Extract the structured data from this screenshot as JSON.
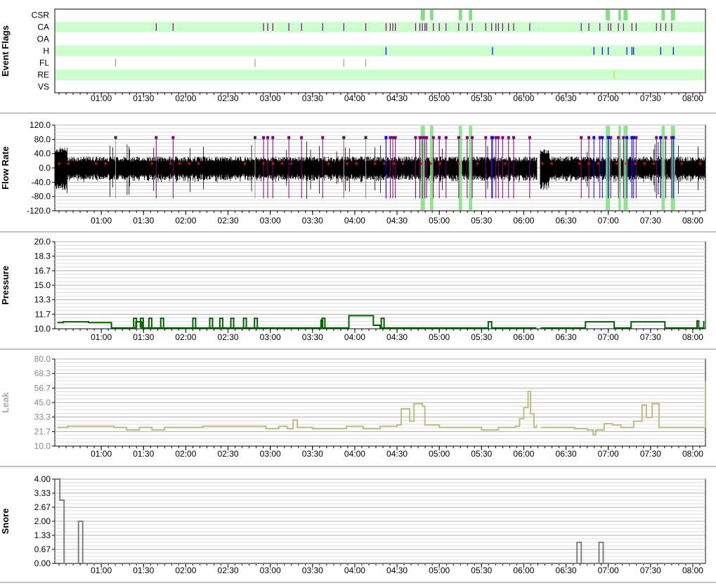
{
  "chart_data": [
    {
      "type": "event-flags",
      "ylabel": "Event Flags",
      "x_ticks": [
        "01:00",
        "01:30",
        "02:00",
        "02:30",
        "03:00",
        "03:30",
        "04:00",
        "04:30",
        "05:00",
        "05:30",
        "06:00",
        "06:30",
        "07:00",
        "07:30",
        "08:00"
      ],
      "rows": [
        {
          "label": "CSR",
          "color": "#7ee07e",
          "spans": [
            [
              4.78,
              4.83
            ],
            [
              4.89,
              4.93
            ],
            [
              5.23,
              5.27
            ],
            [
              5.35,
              5.39
            ],
            [
              6.97,
              7.02
            ],
            [
              7.12,
              7.15
            ],
            [
              7.18,
              7.23
            ],
            [
              7.63,
              7.67
            ],
            [
              7.74,
              7.79
            ]
          ]
        },
        {
          "label": "CA",
          "color": "#800080",
          "events": [
            1.65,
            1.85,
            2.92,
            2.97,
            3.03,
            3.22,
            3.37,
            3.62,
            3.87,
            4.13,
            4.37,
            4.42,
            4.45,
            4.48,
            4.72,
            4.77,
            4.8,
            4.83,
            4.85,
            4.93,
            5.0,
            5.08,
            5.23,
            5.33,
            5.39,
            5.55,
            5.62,
            5.67,
            5.7,
            5.75,
            5.82,
            5.88,
            6.07,
            6.68,
            6.77,
            6.9,
            7.0,
            7.03,
            7.12,
            7.18,
            7.28,
            7.33,
            7.57,
            7.62,
            7.68,
            7.75
          ]
        },
        {
          "label": "OA",
          "color": "#a04040",
          "events": []
        },
        {
          "label": "H",
          "color": "#0000ff",
          "events": [
            4.37,
            5.63,
            6.83,
            6.93,
            7.0,
            7.22,
            7.28,
            7.3,
            7.62,
            7.77
          ]
        },
        {
          "label": "FL",
          "color": "#9a9a9a",
          "events": [
            1.17,
            2.82,
            3.87,
            4.13
          ]
        },
        {
          "label": "RE",
          "color": "#e0e000",
          "events": [
            7.07
          ]
        },
        {
          "label": "VS",
          "color": "#800080",
          "events": [
            0.45
          ]
        }
      ]
    },
    {
      "type": "line",
      "ylabel": "Flow Rate",
      "y_ticks": [
        "120.0",
        "80.0",
        "40.0",
        "0.0",
        "-40.0",
        "-80.0",
        "-120.0"
      ],
      "ylim": [
        -120,
        120
      ],
      "x_ticks": [
        "01:00",
        "01:30",
        "02:00",
        "02:30",
        "03:00",
        "03:30",
        "04:00",
        "04:30",
        "05:00",
        "05:30",
        "06:00",
        "06:30",
        "07:00",
        "07:30",
        "08:00"
      ],
      "series": [
        {
          "color": "#000000",
          "envelope_baseline": [
            -20,
            20
          ]
        }
      ]
    },
    {
      "type": "line",
      "ylabel": "Pressure",
      "y_ticks": [
        "20.0",
        "18.3",
        "16.7",
        "15.0",
        "13.3",
        "11.7",
        "10.0"
      ],
      "ylim": [
        10,
        20
      ],
      "x_ticks": [
        "01:00",
        "01:30",
        "02:00",
        "02:30",
        "03:00",
        "03:30",
        "04:00",
        "04:30",
        "05:00",
        "05:30",
        "06:00",
        "06:30",
        "07:00",
        "07:30",
        "08:00"
      ],
      "series": [
        {
          "color": "#006400",
          "points": [
            [
              0.48,
              10.7
            ],
            [
              0.55,
              10.8
            ],
            [
              0.85,
              10.7
            ],
            [
              1.1,
              10.7
            ],
            [
              1.12,
              10.1
            ],
            [
              1.4,
              10.1
            ],
            [
              1.41,
              10.8
            ],
            [
              1.48,
              10.1
            ],
            [
              1.49,
              10.1
            ],
            [
              1.6,
              10.1
            ],
            [
              1.61,
              10.1
            ],
            [
              1.77,
              10.1
            ],
            [
              1.78,
              10.1
            ],
            [
              3.58,
              10.1
            ],
            [
              3.6,
              11.0
            ],
            [
              3.62,
              10.1
            ],
            [
              3.92,
              10.1
            ],
            [
              3.93,
              11.5
            ],
            [
              4.2,
              11.5
            ],
            [
              4.22,
              10.4
            ],
            [
              4.28,
              10.4
            ],
            [
              4.3,
              10.1
            ],
            [
              5.57,
              10.1
            ],
            [
              5.58,
              10.8
            ],
            [
              5.62,
              10.1
            ],
            [
              6.15,
              10.1
            ]
          ]
        },
        {
          "color": "#006400",
          "points": [
            [
              6.2,
              10.1
            ],
            [
              6.72,
              10.1
            ],
            [
              6.73,
              10.8
            ],
            [
              7.05,
              10.8
            ],
            [
              7.07,
              10.1
            ],
            [
              7.25,
              10.1
            ],
            [
              7.27,
              10.8
            ],
            [
              7.65,
              10.8
            ],
            [
              7.67,
              10.1
            ],
            [
              8.03,
              10.1
            ],
            [
              8.05,
              10.9
            ],
            [
              8.07,
              10.1
            ],
            [
              8.12,
              10.1
            ],
            [
              8.13,
              10.9
            ]
          ]
        }
      ],
      "spikes": [
        1.4,
        1.48,
        1.58,
        1.72,
        2.1,
        2.3,
        2.42,
        2.55,
        2.7,
        2.83,
        3.63,
        4.33
      ]
    },
    {
      "type": "line",
      "ylabel": "Leak",
      "y_ticks": [
        "80.0",
        "68.3",
        "56.7",
        "45.0",
        "33.3",
        "21.7",
        "10.0"
      ],
      "ylim": [
        10,
        80
      ],
      "x_ticks": [
        "01:00",
        "01:30",
        "02:00",
        "02:30",
        "03:00",
        "03:30",
        "04:00",
        "04:30",
        "05:00",
        "05:30",
        "06:00",
        "06:30",
        "07:00",
        "07:30",
        "08:00"
      ],
      "series": [
        {
          "color": "#bdbd80",
          "points": [
            [
              0.48,
              25
            ],
            [
              0.6,
              26
            ],
            [
              1.15,
              25
            ],
            [
              1.3,
              23
            ],
            [
              1.45,
              25
            ],
            [
              1.6,
              23
            ],
            [
              1.75,
              25
            ],
            [
              2.2,
              26
            ],
            [
              2.8,
              26
            ],
            [
              2.95,
              24
            ],
            [
              3.1,
              26
            ],
            [
              3.2,
              24
            ],
            [
              3.27,
              31
            ],
            [
              3.32,
              25
            ],
            [
              3.5,
              24
            ],
            [
              3.9,
              26
            ],
            [
              4.1,
              24
            ],
            [
              4.3,
              26
            ],
            [
              4.5,
              27
            ],
            [
              4.55,
              40
            ],
            [
              4.65,
              30
            ],
            [
              4.7,
              44
            ],
            [
              4.8,
              42
            ],
            [
              4.83,
              27
            ],
            [
              5.0,
              25
            ],
            [
              5.3,
              25
            ],
            [
              5.5,
              23
            ],
            [
              5.7,
              25
            ],
            [
              5.9,
              26
            ],
            [
              5.95,
              32
            ],
            [
              6.0,
              41
            ],
            [
              6.05,
              54
            ],
            [
              6.08,
              36
            ],
            [
              6.12,
              25
            ],
            [
              6.15,
              27
            ]
          ],
          "gap_after": 6.15
        },
        {
          "color": "#bdbd80",
          "points": [
            [
              6.2,
              25
            ],
            [
              6.6,
              24
            ],
            [
              6.75,
              23
            ],
            [
              6.82,
              19
            ],
            [
              6.85,
              23
            ],
            [
              6.95,
              28
            ],
            [
              7.05,
              27
            ],
            [
              7.15,
              25
            ],
            [
              7.3,
              30
            ],
            [
              7.4,
              43
            ],
            [
              7.45,
              33
            ],
            [
              7.52,
              44
            ],
            [
              7.6,
              25
            ],
            [
              7.9,
              25
            ],
            [
              8.13,
              25
            ],
            [
              8.15,
              62
            ]
          ]
        }
      ]
    },
    {
      "type": "line",
      "ylabel": "Snore",
      "y_ticks": [
        "4.00",
        "3.33",
        "2.67",
        "2.00",
        "1.33",
        "0.67",
        "0.00"
      ],
      "ylim": [
        0,
        4
      ],
      "x_ticks": [
        "01:00",
        "01:30",
        "02:00",
        "02:30",
        "03:00",
        "03:30",
        "04:00",
        "04:30",
        "05:00",
        "05:30",
        "06:00",
        "06:30",
        "07:00",
        "07:30",
        "08:00"
      ],
      "series": [
        {
          "color": "#808080",
          "points": [
            [
              0.45,
              4
            ],
            [
              0.5,
              4
            ],
            [
              0.51,
              3
            ],
            [
              0.55,
              3
            ],
            [
              0.56,
              0
            ],
            [
              0.72,
              0
            ],
            [
              0.73,
              2
            ],
            [
              0.77,
              2
            ],
            [
              0.78,
              0
            ],
            [
              6.15,
              0
            ]
          ]
        },
        {
          "color": "#808080",
          "points": [
            [
              6.2,
              0
            ],
            [
              6.62,
              0
            ],
            [
              6.63,
              1
            ],
            [
              6.67,
              1
            ],
            [
              6.68,
              0
            ],
            [
              6.88,
              0
            ],
            [
              6.89,
              1
            ],
            [
              6.93,
              1
            ],
            [
              6.94,
              0
            ],
            [
              8.15,
              0
            ]
          ]
        }
      ]
    }
  ]
}
